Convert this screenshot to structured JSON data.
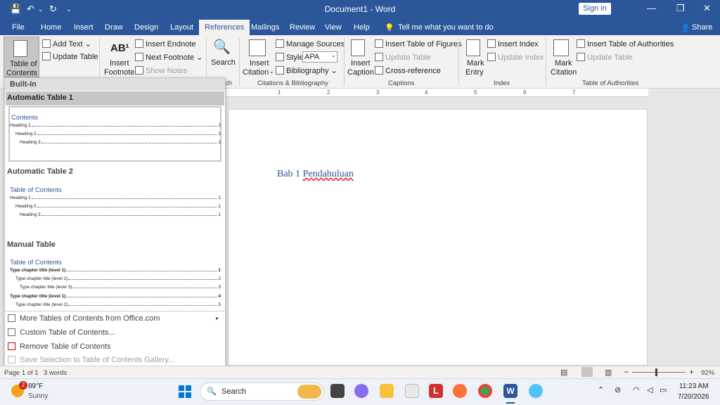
{
  "titlebar": {
    "title": "Document1 - Word",
    "signin": "Sign in",
    "qa": [
      "💾",
      "↶",
      "⌄",
      "↻",
      "⌄"
    ],
    "min": "—",
    "restore": "❐",
    "close": "✕"
  },
  "tabs": [
    "File",
    "Home",
    "Insert",
    "Draw",
    "Design",
    "Layout",
    "References",
    "Mailings",
    "Review",
    "View",
    "Help"
  ],
  "tell_me": "Tell me what you want to do",
  "share": "Share",
  "ribbon": {
    "toc": {
      "label1": "Table of",
      "label2": "Contents",
      "add_text": "Add Text",
      "update_table": "Update Table"
    },
    "footnotes": {
      "insert_footnote1": "Insert",
      "insert_footnote2": "Footnote",
      "insert_endnote": "Insert Endnote",
      "next_footnote": "Next Footnote",
      "show_notes": "Show Notes"
    },
    "research": {
      "search": "Search",
      "group": "ch"
    },
    "citations": {
      "insert_citation1": "Insert",
      "insert_citation2": "Citation",
      "manage_sources": "Manage Sources",
      "style_label": "Style:",
      "style_value": "APA",
      "bibliography": "Bibliography",
      "group": "Citations & Bibliography"
    },
    "captions": {
      "insert_caption1": "Insert",
      "insert_caption2": "Caption",
      "insert_tof": "Insert Table of Figures",
      "update_table": "Update Table",
      "cross_ref": "Cross-reference",
      "group": "Captions"
    },
    "index": {
      "mark_entry1": "Mark",
      "mark_entry2": "Entry",
      "insert_index": "Insert Index",
      "update_index": "Update Index",
      "group": "Index"
    },
    "toa": {
      "mark_citation1": "Mark",
      "mark_citation2": "Citation",
      "insert_toa": "Insert Table of Authorities",
      "update_table": "Update Table",
      "group": "Table of Authorities"
    }
  },
  "dropdown": {
    "builtin": "Built-In",
    "auto1": {
      "title": "Automatic Table 1",
      "heading": "Contents",
      "lines": [
        {
          "text": "Heading 1",
          "page": "1"
        },
        {
          "text": "Heading 2",
          "page": "1"
        },
        {
          "text": "Heading 3",
          "page": "1"
        }
      ]
    },
    "auto2": {
      "title": "Automatic Table 2",
      "heading": "Table of Contents",
      "lines": [
        {
          "text": "Heading 1",
          "page": "1"
        },
        {
          "text": "Heading 2",
          "page": "1"
        },
        {
          "text": "Heading 3",
          "page": "1"
        }
      ]
    },
    "manual": {
      "title": "Manual Table",
      "heading": "Table of Contents",
      "lines": [
        {
          "text": "Type chapter title (level 1)",
          "page": "1"
        },
        {
          "text": "Type chapter title (level 2)",
          "page": "2"
        },
        {
          "text": "Type chapter title (level 3)",
          "page": "3"
        },
        {
          "text": "Type chapter title (level 1)",
          "page": "4"
        },
        {
          "text": "Type chapter title (level 2)",
          "page": "5"
        }
      ]
    },
    "menu": {
      "more": "More Tables of Contents from Office.com",
      "custom": "Custom Table of Contents...",
      "remove": "Remove Table of Contents",
      "save": "Save Selection to Table of Contents Gallery..."
    }
  },
  "document": {
    "heading_a": "Bab 1 ",
    "heading_b": "Pendahuluan"
  },
  "ruler": [
    "1",
    "2",
    "3",
    "4",
    "5",
    "6",
    "7"
  ],
  "status": {
    "page": "Page 1 of 1",
    "words": "3 words",
    "zoom": "92%",
    "minus": "−",
    "plus": "+"
  },
  "taskbar": {
    "temp": "89°F",
    "weather": "Sunny",
    "badge": "2",
    "search": "Search",
    "time": "11:23 AM",
    "date": "7/20/2026"
  }
}
